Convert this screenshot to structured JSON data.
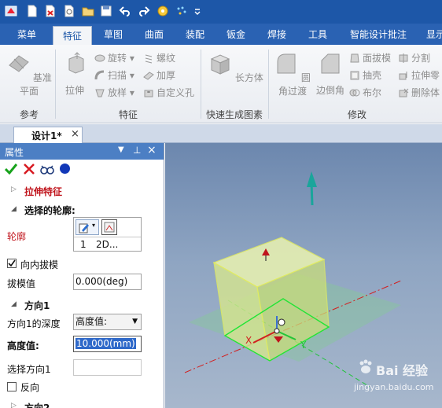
{
  "ribbon_tabs": [
    "菜单",
    "特征",
    "草图",
    "曲面",
    "装配",
    "钣金",
    "焊接",
    "工具",
    "智能设计批注",
    "显示"
  ],
  "active_tab": "特征",
  "groups": {
    "reference": {
      "label": "参考",
      "datum_plane": "基准平面"
    },
    "feature": {
      "label": "特征",
      "extrude": "拉伸",
      "revolve": "旋转",
      "sweep": "扫描",
      "loft": "放样",
      "thread": "螺纹",
      "thicken": "加厚",
      "custom_hole": "自定义孔"
    },
    "quick": {
      "label": "快速生成图素",
      "cuboid": "长方体"
    },
    "modify": {
      "label": "修改",
      "fillet": "圆角过渡",
      "chamfer": "边倒角",
      "face_draft": "面拔模",
      "shell": "抽壳",
      "boolean": "布尔",
      "split": "分割",
      "extrude_part": "拉伸零",
      "delete_body": "删除体"
    }
  },
  "document_tab": "设计1*",
  "panel": {
    "title": "属性",
    "feature_title": "拉伸特征",
    "section_profile": "选择的轮廓:",
    "profile_label": "轮廓",
    "profile_item_num": "1",
    "profile_item_name": "2D...",
    "draft_inward_label": "向内拔模",
    "draft_inward_checked": true,
    "draft_value_label": "拔模值",
    "draft_value": "0.000(deg)",
    "section_dir1": "方向1",
    "dir1_depth_label": "方向1的深度",
    "dir1_depth_value": "高度值:",
    "height_label": "高度值:",
    "height_value": "10.000(mm)",
    "select_dir1_label": "选择方向1",
    "reverse_label": "反向",
    "reverse_checked": false,
    "section_dir2": "方向2"
  },
  "viewport": {
    "axis_x": "X",
    "axis_y": "Y",
    "watermark": "Bai 经验",
    "watermark_url": "jingyan.baidu.com"
  },
  "colors": {
    "title_bar": "#1d57a8",
    "tab_bar": "#2a62b3",
    "accent_red": "#c0141c",
    "solid_fill": "#d6e68f"
  }
}
